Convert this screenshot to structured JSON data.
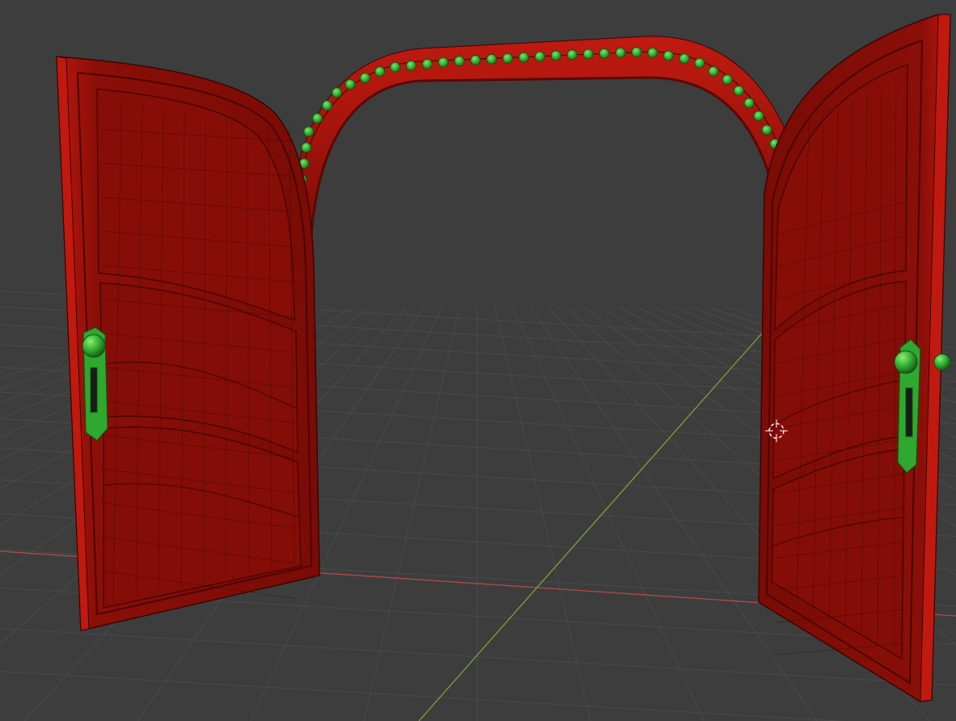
{
  "viewport": {
    "background_color": "#3d3d3d",
    "grid_color": "#4a4a4a",
    "x_axis_color": "#b04a4a",
    "y_axis_color": "#7aa33a"
  },
  "scene": {
    "object": "double-door-arch",
    "door_color": "#8a0f08",
    "door_panel_color": "#7d0c07",
    "door_highlight_color": "#b8170f",
    "wireframe_color": "#2a0402",
    "hardware_color": "#2fa82f",
    "hardware_highlight_color": "#6bdc5a",
    "arch_bead_count": 37,
    "icons": {
      "cursor": "3d-cursor-icon",
      "handle": "door-handle-icon"
    }
  }
}
